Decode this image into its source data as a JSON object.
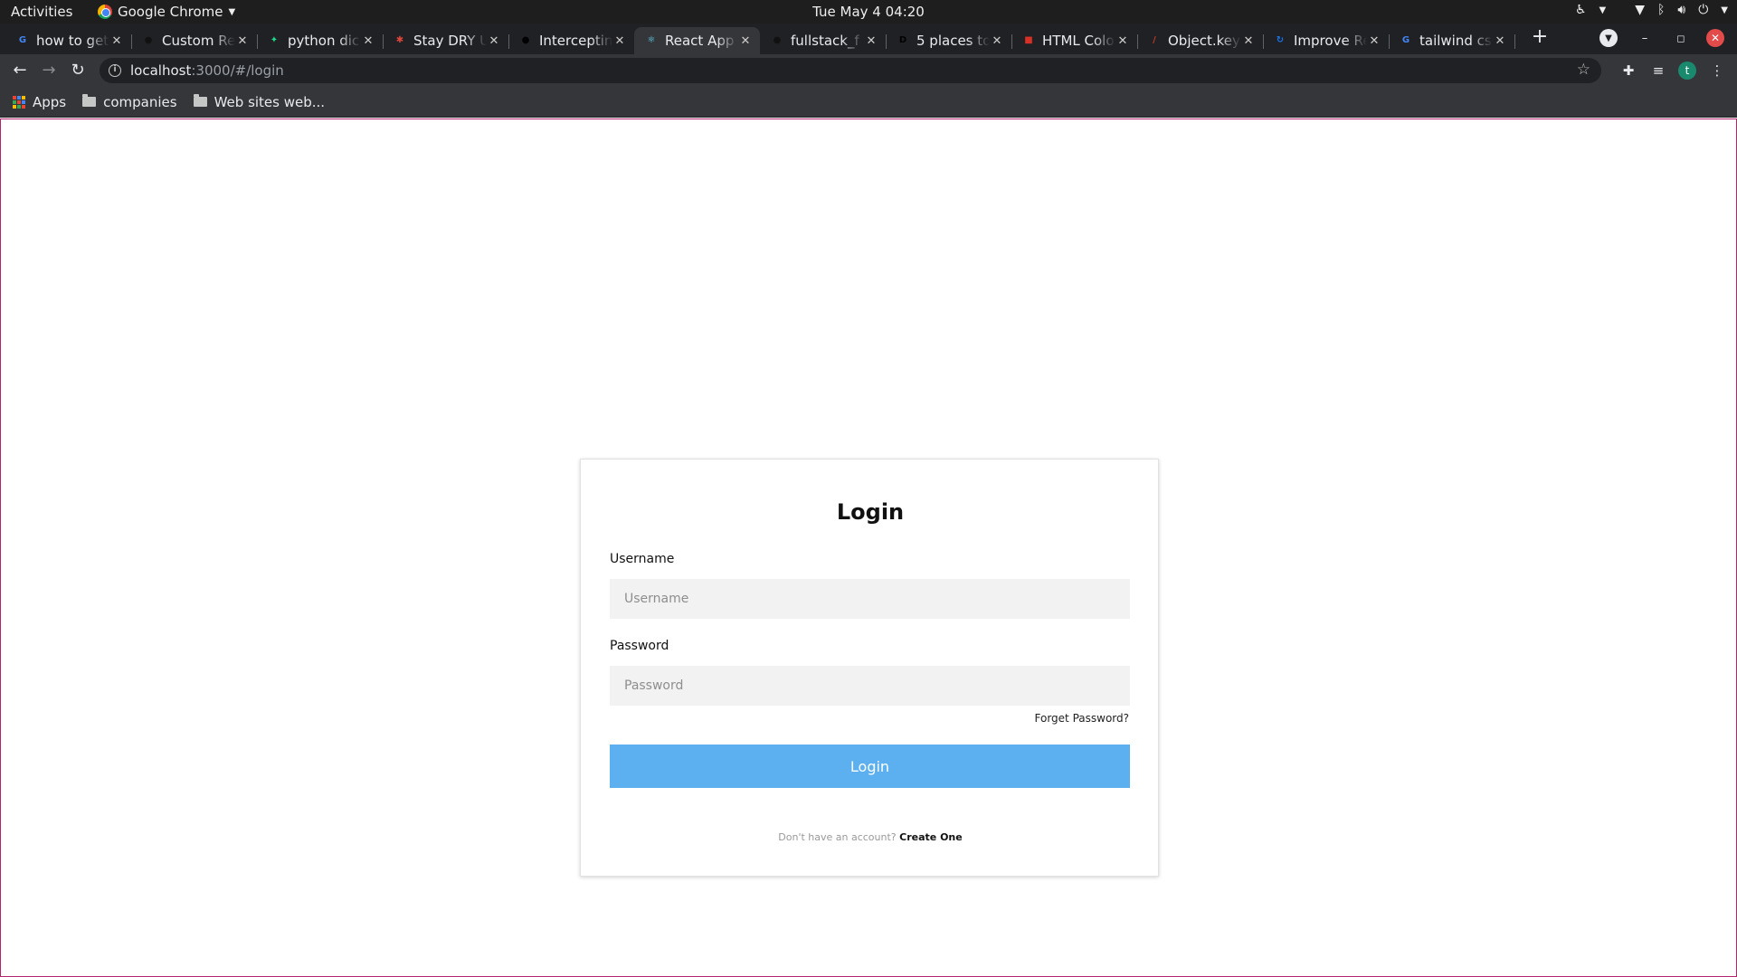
{
  "os_topbar": {
    "activities": "Activities",
    "app_name": "Google Chrome",
    "clock": "Tue May 4  04:20"
  },
  "tabs": [
    {
      "title": "how to get",
      "favicon": "google-icon",
      "color": "#4285f4"
    },
    {
      "title": "Custom Re",
      "favicon": "github-icon",
      "color": "#111111"
    },
    {
      "title": "python dic",
      "favicon": "pycharm-icon",
      "color": "#21d789"
    },
    {
      "title": "Stay DRY U",
      "favicon": "asterisk-icon",
      "color": "#e0453a"
    },
    {
      "title": "Interceptin",
      "favicon": "medium-icon",
      "color": "#000000"
    },
    {
      "title": "React App",
      "favicon": "react-icon",
      "color": "#61dafb",
      "active": true
    },
    {
      "title": "fullstack_f",
      "favicon": "github-icon",
      "color": "#111111"
    },
    {
      "title": "5 places to",
      "favicon": "dev-icon",
      "color": "#000000"
    },
    {
      "title": "HTML Colo",
      "favicon": "htmlcolor-icon",
      "color": "#d93025"
    },
    {
      "title": "Object.key",
      "favicon": "mdn-icon",
      "color": "#c0392b"
    },
    {
      "title": "Improve Re",
      "favicon": "refresh-icon",
      "color": "#1a73e8"
    },
    {
      "title": "tailwind cs",
      "favicon": "google-icon",
      "color": "#4285f4"
    }
  ],
  "omnibox": {
    "host": "localhost",
    "path": ":3000/#/login"
  },
  "bookmarks": [
    {
      "label": "Apps",
      "icon": "apps-grid-icon"
    },
    {
      "label": "companies",
      "icon": "folder-icon"
    },
    {
      "label": "Web sites web...",
      "icon": "folder-icon"
    }
  ],
  "profile_initial": "t",
  "login": {
    "title": "Login",
    "username_label": "Username",
    "username_placeholder": "Username",
    "password_label": "Password",
    "password_placeholder": "Password",
    "forgot": "Forget Password?",
    "button": "Login",
    "no_account": "Don't have an account?",
    "create": "Create One"
  },
  "colors": {
    "login_button": "#5cb0ef",
    "viewport_border": "#b3256b"
  }
}
